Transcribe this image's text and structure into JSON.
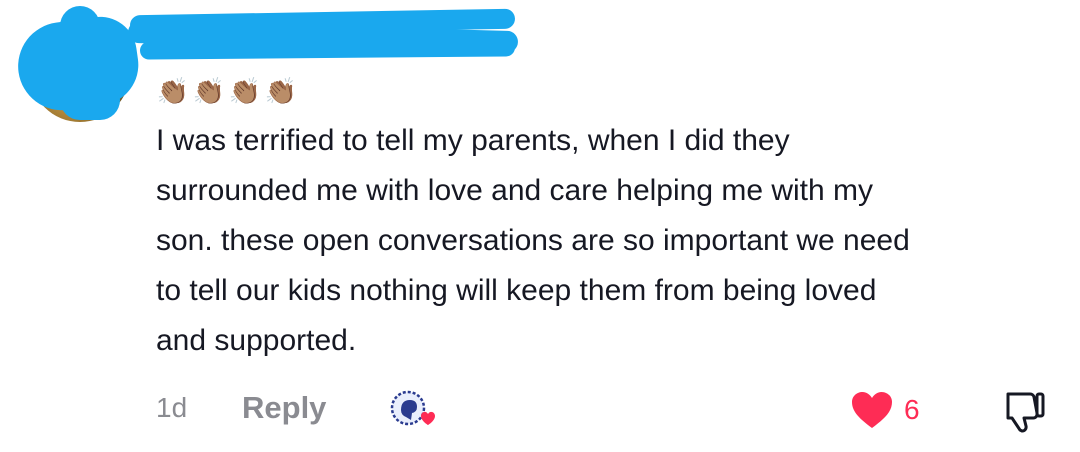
{
  "comment": {
    "username": "",
    "emoji": [
      "👏🏽",
      "👏🏽",
      "👏🏽",
      "👏🏽"
    ],
    "text": "I was terrified to tell my parents, when I did they\nsurrounded me with love and care helping me with my\nson. these open conversations are so important we need\nto tell our kids nothing will keep them from being loved\nand supported.",
    "age": "1d",
    "reply_label": "Reply",
    "like_count": "6",
    "liked": true,
    "colors": {
      "like": "#fe2c55",
      "muted": "#8a8b91",
      "text": "#161823",
      "redaction": "#1aa8ee"
    },
    "icons": {
      "reply_sticker": "heart-brain-sticker-icon",
      "like": "heart-icon",
      "dislike": "thumbs-down-icon"
    }
  }
}
